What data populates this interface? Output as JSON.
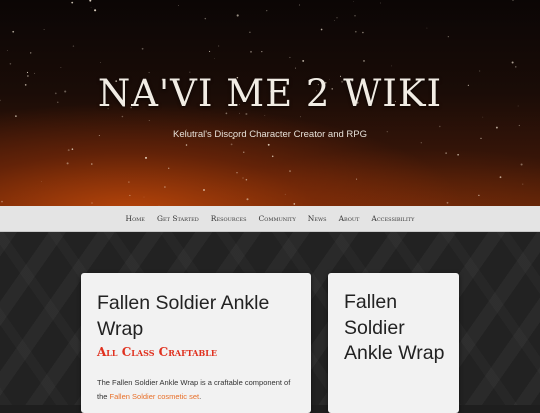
{
  "site": {
    "title": "NA'VI ME 2 WIKI",
    "tagline": "Kelutral's Discord Character Creator and RPG"
  },
  "nav": {
    "items": [
      "Home",
      "Get Started",
      "Resources",
      "Community",
      "News",
      "About",
      "Accessibility"
    ]
  },
  "article": {
    "title": "Fallen Soldier Ankle Wrap",
    "subtitle": "All Class Craftable",
    "body_before": "The Fallen Soldier Ankle Wrap is a craftable component of the ",
    "body_link": "Fallen Soldier cosmetic set",
    "body_after": "."
  },
  "infobox": {
    "title": "Fallen Soldier Ankle Wrap"
  },
  "colors": {
    "accent_red": "#e0301e",
    "link_orange": "#e8702a",
    "nav_bg": "#e4e4e4"
  }
}
